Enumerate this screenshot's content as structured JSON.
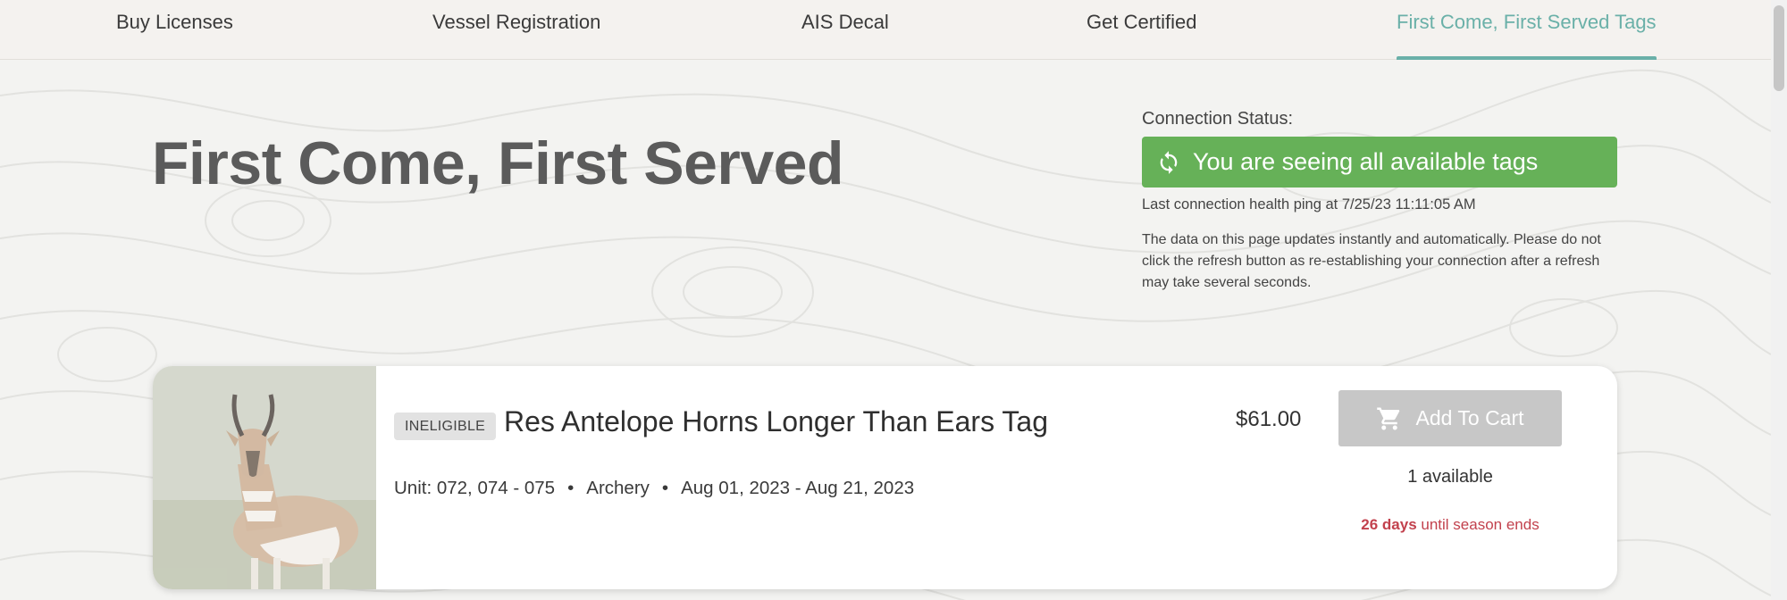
{
  "nav": {
    "items": [
      {
        "label": "Buy Licenses"
      },
      {
        "label": "Vessel Registration"
      },
      {
        "label": "AIS Decal"
      },
      {
        "label": "Get Certified"
      },
      {
        "label": "First Come, First Served Tags"
      }
    ],
    "active_color": "#6ab0a8"
  },
  "page": {
    "title": "First Come, First Served"
  },
  "connection": {
    "label": "Connection Status:",
    "status_text": "You are seeing all available tags",
    "status_color": "#66b158",
    "status_icon": "sync-icon",
    "last_ping": "Last connection health ping at 7/25/23 11:11:05 AM",
    "info": "The data on this page updates instantly and automatically. Please do not click the refresh button as re-establishing your connection after a refresh may take several seconds."
  },
  "tags": [
    {
      "image": "pronghorn-antelope-photo",
      "badge": "INELIGIBLE",
      "title": "Res Antelope Horns Longer Than Ears Tag",
      "unit": "Unit: 072, 074 - 075",
      "method": "Archery",
      "dates": "Aug 01, 2023 - Aug 21, 2023",
      "separator": "•",
      "price": "$61.00",
      "cart_label": "Add To Cart",
      "cart_icon": "cart-icon",
      "available": "1 available",
      "days": "26 days",
      "season_suffix": "until season ends",
      "season_color": "#c2414d"
    }
  ]
}
